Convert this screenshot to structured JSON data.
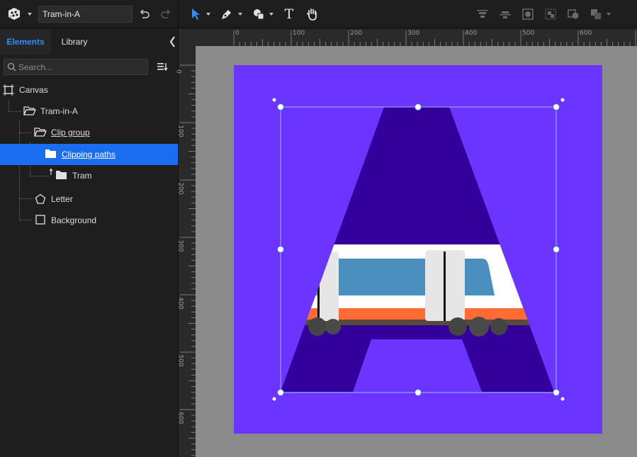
{
  "toolbar": {
    "document_name": "Tram-in-A",
    "icons": [
      "app-menu-icon",
      "undo-icon",
      "redo-icon",
      "select-tool-icon",
      "pen-tool-icon",
      "shapes-tool-icon",
      "text-tool-icon",
      "hand-tool-icon",
      "align-top-icon",
      "align-middle-icon",
      "mask-icon",
      "group-icon",
      "boolean-icon",
      "arrange-icon"
    ],
    "text_tool_glyph": "T"
  },
  "panel": {
    "tabs": [
      {
        "label": "Elements",
        "active": true
      },
      {
        "label": "Library",
        "active": false
      }
    ],
    "search": {
      "placeholder": "Search...",
      "value": ""
    },
    "tree": [
      {
        "label": "Canvas",
        "icon": "canvas-icon",
        "level": 0
      },
      {
        "label": "Tram-in-A",
        "icon": "folder-open-icon",
        "level": 1
      },
      {
        "label": "Clip group",
        "icon": "folder-open-icon",
        "level": 2
      },
      {
        "label": "Clipping paths",
        "icon": "folder-icon",
        "level": 3,
        "selected": true
      },
      {
        "label": "Tram",
        "icon": "folder-icon",
        "level": 3,
        "clipped": true
      },
      {
        "label": "Letter",
        "icon": "pentagon-icon",
        "level": 2
      },
      {
        "label": "Background",
        "icon": "rectangle-icon",
        "level": 2
      }
    ]
  },
  "rulers": {
    "top_labels": [
      "0",
      "100",
      "200",
      "300",
      "400",
      "500",
      "600"
    ],
    "left_labels": [
      "0",
      "100",
      "200",
      "300",
      "400",
      "500",
      "600"
    ]
  },
  "colors": {
    "accent": "#1a6cf0",
    "tab_active": "#2f8cff",
    "artboard": "#6b35ff",
    "letter": "#33009c",
    "tram_blue": "#4b8fbf",
    "tram_orange": "#ff6b35",
    "tram_white": "#ffffff",
    "selection": "#9fb8ff"
  }
}
